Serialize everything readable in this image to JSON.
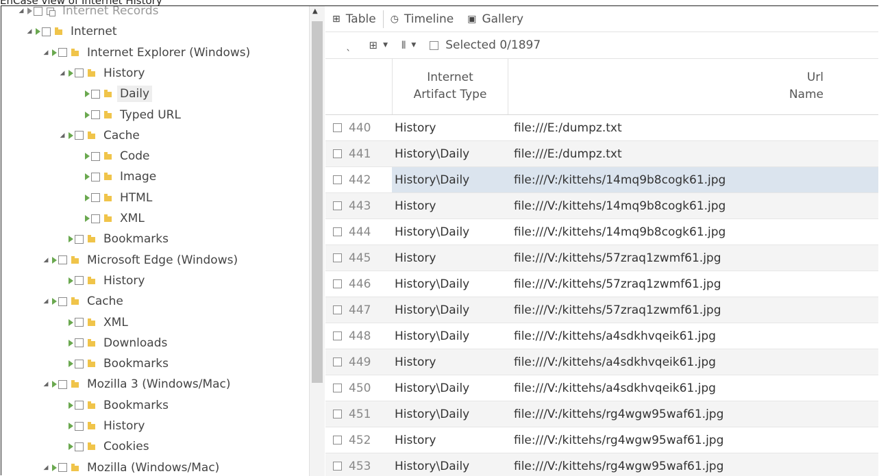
{
  "caption": "EnCase view of Internet History",
  "tree": {
    "items": [
      {
        "label": "Internet Records",
        "expander": "◢",
        "icon": "record",
        "dim": true
      },
      {
        "label": "Internet",
        "expander": "◢",
        "icon": "folder"
      },
      {
        "label": "Internet Explorer (Windows)",
        "expander": "◢",
        "icon": "folder"
      },
      {
        "label": "History",
        "expander": "◢",
        "icon": "folder"
      },
      {
        "label": "Daily",
        "expander": "",
        "icon": "folder",
        "highlight": true
      },
      {
        "label": "Typed URL",
        "expander": "",
        "icon": "folder"
      },
      {
        "label": "Cache",
        "expander": "◢",
        "icon": "folder"
      },
      {
        "label": "Code",
        "expander": "",
        "icon": "folder"
      },
      {
        "label": "Image",
        "expander": "",
        "icon": "folder"
      },
      {
        "label": "HTML",
        "expander": "",
        "icon": "folder"
      },
      {
        "label": "XML",
        "expander": "",
        "icon": "folder"
      },
      {
        "label": "Bookmarks",
        "expander": "",
        "icon": "folder"
      },
      {
        "label": "Microsoft Edge (Windows)",
        "expander": "◢",
        "icon": "folder"
      },
      {
        "label": "History",
        "expander": "",
        "icon": "folder"
      },
      {
        "label": "Cache",
        "expander": "◢",
        "icon": "folder"
      },
      {
        "label": "XML",
        "expander": "",
        "icon": "folder"
      },
      {
        "label": "Downloads",
        "expander": "",
        "icon": "folder"
      },
      {
        "label": "Bookmarks",
        "expander": "",
        "icon": "folder"
      },
      {
        "label": "Mozilla 3 (Windows/Mac)",
        "expander": "◢",
        "icon": "folder"
      },
      {
        "label": "Bookmarks",
        "expander": "",
        "icon": "folder"
      },
      {
        "label": "History",
        "expander": "",
        "icon": "folder"
      },
      {
        "label": "Cookies",
        "expander": "",
        "icon": "folder"
      },
      {
        "label": "Mozilla (Windows/Mac)",
        "expander": "◢",
        "icon": "folder"
      }
    ]
  },
  "tabs": [
    {
      "label": "Table",
      "icon": "table-icon",
      "glyph": "⊞"
    },
    {
      "label": "Timeline",
      "icon": "clock-icon",
      "glyph": "◷"
    },
    {
      "label": "Gallery",
      "icon": "picture-icon",
      "glyph": "▣"
    }
  ],
  "toolbar": {
    "back_glyph": "ˎ",
    "grid_glyph": "⊞",
    "sort_glyph": "⫴",
    "dropdown_glyph": "▼",
    "selected_label": "Selected 0/1897"
  },
  "grid": {
    "col_type_line1": "Internet",
    "col_type_line2": "Artifact Type",
    "col_url_line1": "Url",
    "col_url_line2": "Name",
    "rows": [
      {
        "num": "440",
        "type": "History",
        "url": "file:///E:/dumpz.txt"
      },
      {
        "num": "441",
        "type": "History\\Daily",
        "url": "file:///E:/dumpz.txt"
      },
      {
        "num": "442",
        "type": "History\\Daily",
        "url": "file:///V:/kittehs/14mq9b8cogk61.jpg"
      },
      {
        "num": "443",
        "type": "History",
        "url": "file:///V:/kittehs/14mq9b8cogk61.jpg"
      },
      {
        "num": "444",
        "type": "History\\Daily",
        "url": "file:///V:/kittehs/14mq9b8cogk61.jpg"
      },
      {
        "num": "445",
        "type": "History",
        "url": "file:///V:/kittehs/57zraq1zwmf61.jpg"
      },
      {
        "num": "446",
        "type": "History\\Daily",
        "url": "file:///V:/kittehs/57zraq1zwmf61.jpg"
      },
      {
        "num": "447",
        "type": "History\\Daily",
        "url": "file:///V:/kittehs/57zraq1zwmf61.jpg"
      },
      {
        "num": "448",
        "type": "History\\Daily",
        "url": "file:///V:/kittehs/a4sdkhvqeik61.jpg"
      },
      {
        "num": "449",
        "type": "History",
        "url": "file:///V:/kittehs/a4sdkhvqeik61.jpg"
      },
      {
        "num": "450",
        "type": "History\\Daily",
        "url": "file:///V:/kittehs/a4sdkhvqeik61.jpg"
      },
      {
        "num": "451",
        "type": "History\\Daily",
        "url": "file:///V:/kittehs/rg4wgw95waf61.jpg"
      },
      {
        "num": "452",
        "type": "History",
        "url": "file:///V:/kittehs/rg4wgw95waf61.jpg"
      },
      {
        "num": "453",
        "type": "History\\Daily",
        "url": "file:///V:/kittehs/rg4wgw95waf61.jpg"
      }
    ],
    "selected_row": "442"
  }
}
